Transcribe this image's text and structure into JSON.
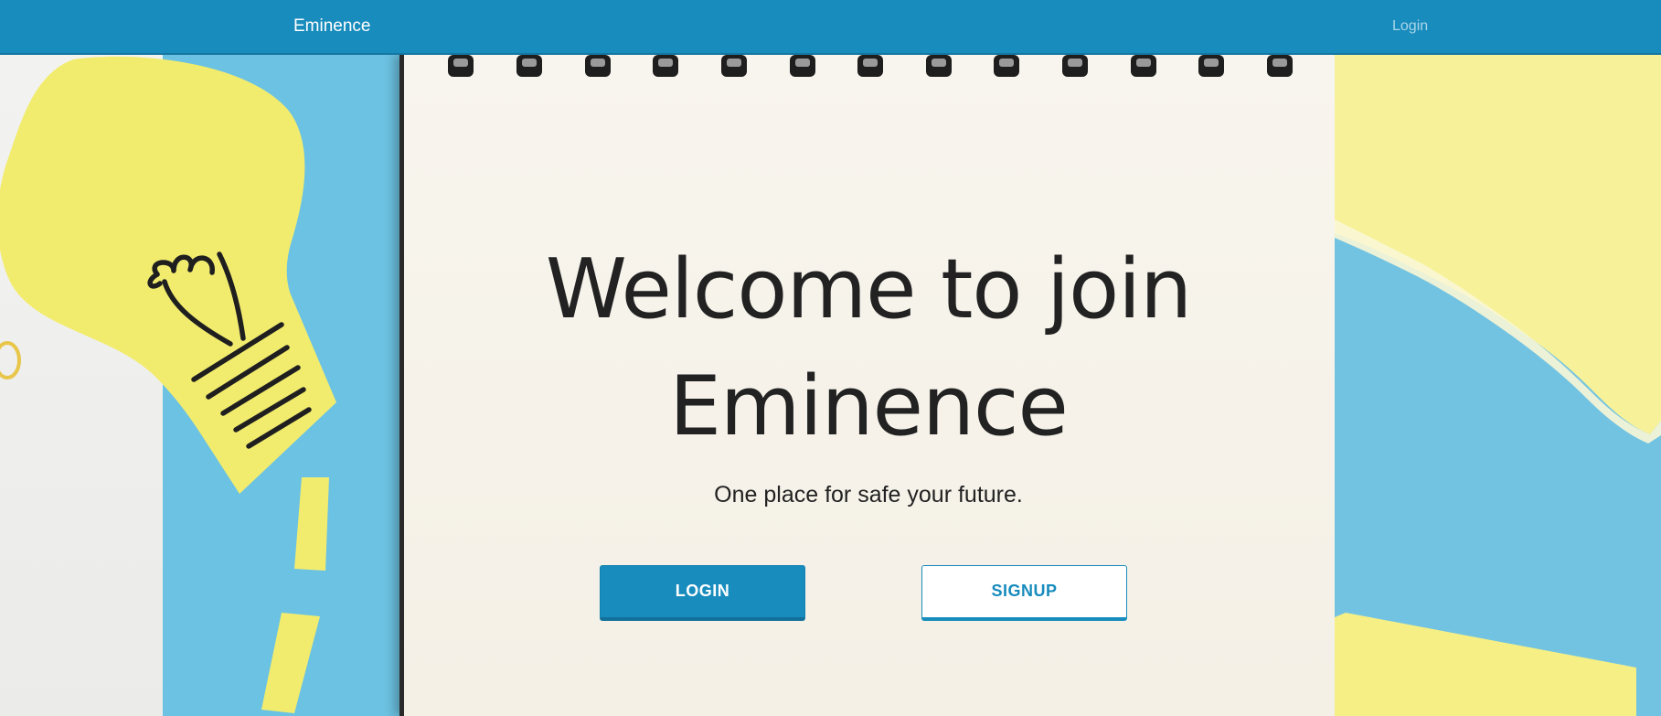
{
  "navbar": {
    "brand": "Eminence",
    "login_link": "Login"
  },
  "hero": {
    "title_line1": "Welcome to join",
    "title_line2": "Eminence",
    "subtitle": "One place for safe your future.",
    "login_button": "LOGIN",
    "signup_button": "SIGNUP"
  },
  "colors": {
    "primary": "#188cbd",
    "nav_link": "#a9d6ea",
    "text_dark": "#222222",
    "paper_yellow": "#f2ec6e",
    "paper_blue": "#6cc2e2"
  },
  "icons": {
    "lightbulb": "lightbulb-paper-cutout",
    "notebook": "spiral-notebook"
  }
}
